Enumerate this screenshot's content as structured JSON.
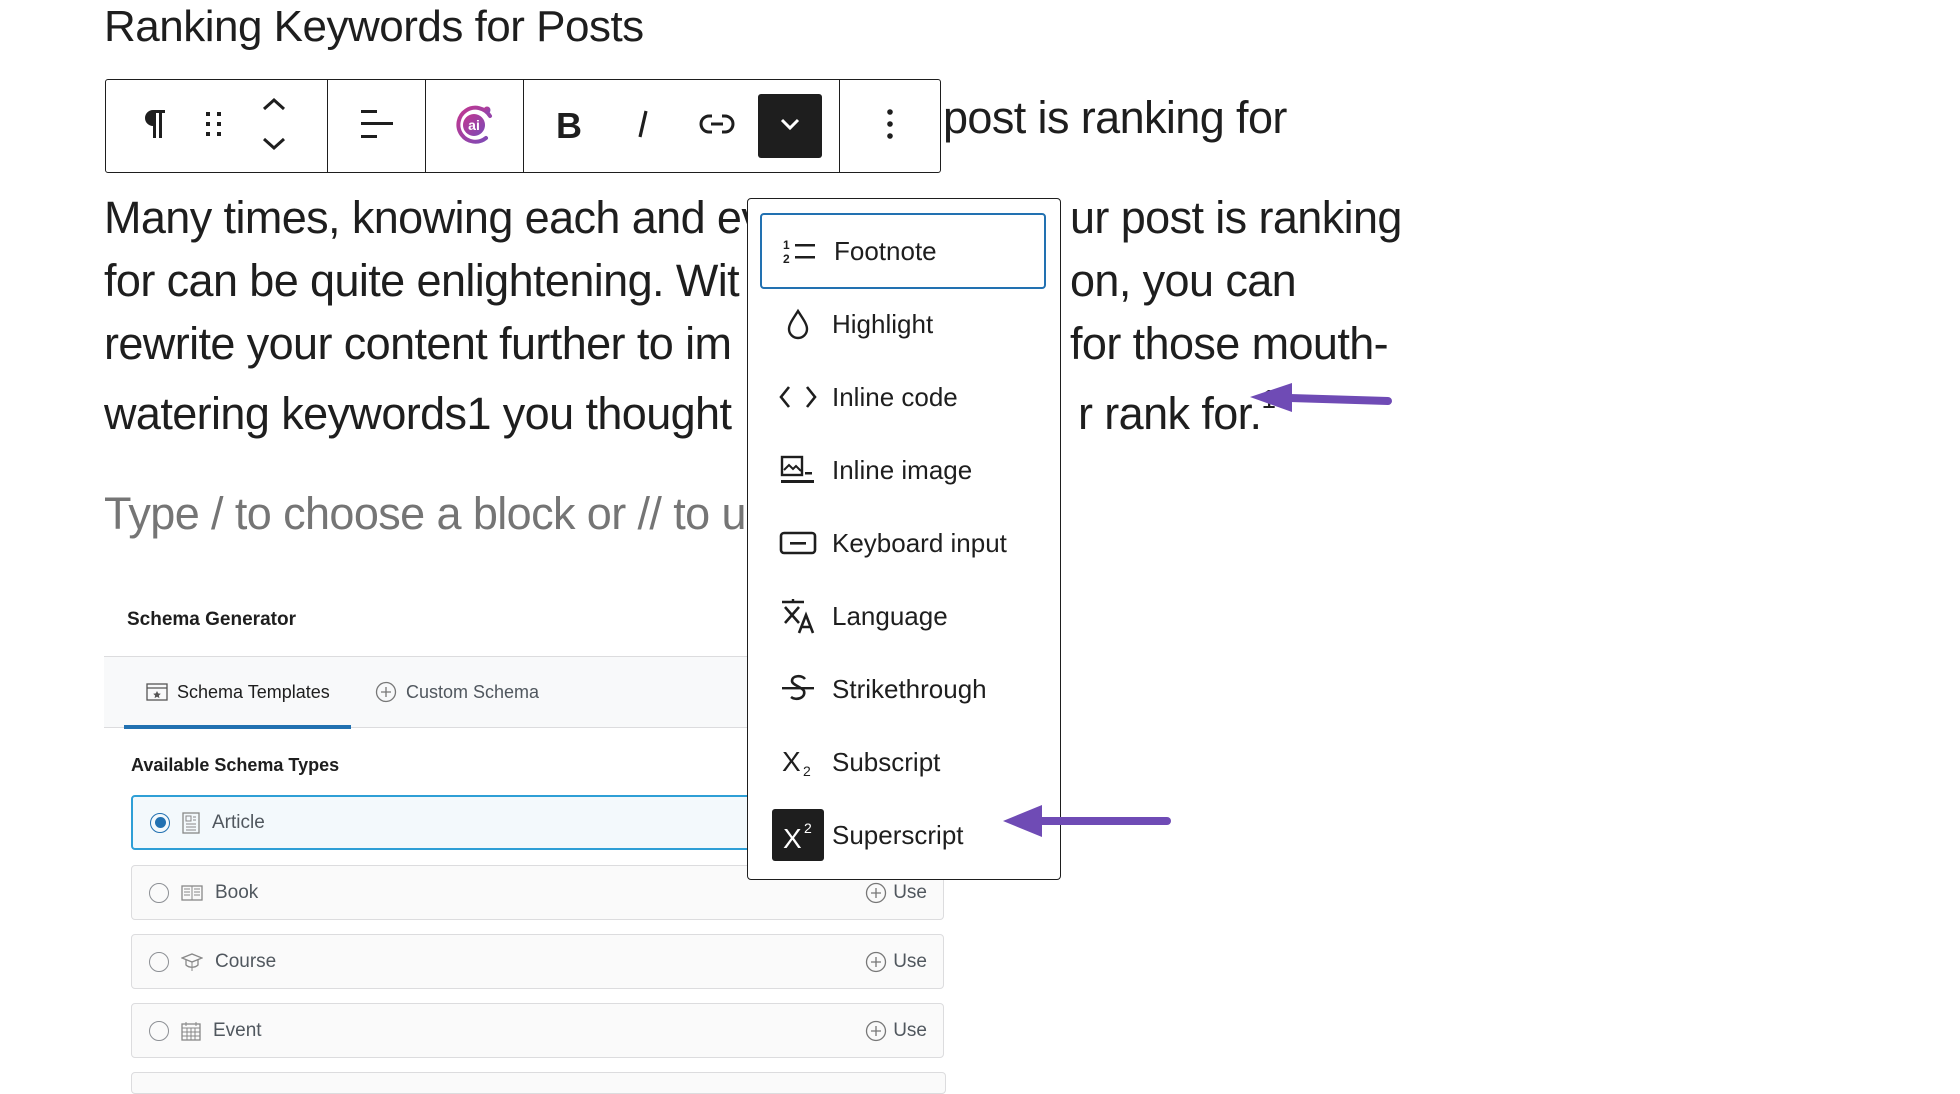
{
  "heading": "Ranking Keywords for Posts",
  "paragraph": {
    "line0_tail": "post is ranking for",
    "line1_left": "Many times, knowing each and ev",
    "line1_right": "ur post is ranking",
    "line2_left": "for can be quite enlightening. Wit",
    "line2_right": "on, you can",
    "line3_left": "rewrite your content further to im",
    "line3_right": "for those mouth-",
    "line4_left": "watering keywords1 you thought",
    "line4_right": "r rank for.",
    "footnote_marker": "1"
  },
  "placeholder": "Type / to choose a block or // to u",
  "toolbar": {
    "buttons": [
      {
        "icon": "paragraph-icon",
        "label": "Paragraph"
      },
      {
        "icon": "drag-handle-icon",
        "label": "Drag"
      },
      {
        "icon": "move-up-down-icon",
        "label": "Move up/down"
      },
      {
        "icon": "align-icon",
        "label": "Align text"
      },
      {
        "icon": "ai-assistant-icon",
        "label": "AI"
      },
      {
        "icon": "bold-icon",
        "label": "Bold"
      },
      {
        "icon": "italic-icon",
        "label": "Italic"
      },
      {
        "icon": "link-icon",
        "label": "Link"
      },
      {
        "icon": "more-rich-text-chevron-icon",
        "label": "More",
        "active": true
      },
      {
        "icon": "options-kebab-icon",
        "label": "Options"
      }
    ],
    "ai_gradient": [
      "#c2368f",
      "#7b4bb7"
    ]
  },
  "format_menu": {
    "items": [
      {
        "label": "Footnote",
        "icon": "footnote-icon",
        "focused": true
      },
      {
        "label": "Highlight",
        "icon": "highlight-drop-icon"
      },
      {
        "label": "Inline code",
        "icon": "code-brackets-icon"
      },
      {
        "label": "Inline image",
        "icon": "inline-image-icon"
      },
      {
        "label": "Keyboard input",
        "icon": "keyboard-icon"
      },
      {
        "label": "Language",
        "icon": "language-icon"
      },
      {
        "label": "Strikethrough",
        "icon": "strikethrough-icon"
      },
      {
        "label": "Subscript",
        "icon": "subscript-icon"
      },
      {
        "label": "Superscript",
        "icon": "superscript-icon",
        "active": true
      }
    ],
    "focus_color": "#2271b1"
  },
  "annotation_arrow_color": "#6f4bb5",
  "schema": {
    "title": "Schema Generator",
    "tabs": [
      {
        "label": "Schema Templates",
        "icon": "schema-templates-icon",
        "active": true
      },
      {
        "label": "Custom Schema",
        "icon": "plus-circle-icon"
      }
    ],
    "types_label": "Available Schema Types",
    "rows": [
      {
        "label": "Article",
        "icon": "article-icon",
        "selected": true,
        "action": ""
      },
      {
        "label": "Book",
        "icon": "book-icon",
        "selected": false,
        "action": "Use"
      },
      {
        "label": "Course",
        "icon": "course-cap-icon",
        "selected": false,
        "action": "Use"
      },
      {
        "label": "Event",
        "icon": "calendar-icon",
        "selected": false,
        "action": "Use"
      }
    ],
    "accent": "#2271b1"
  }
}
